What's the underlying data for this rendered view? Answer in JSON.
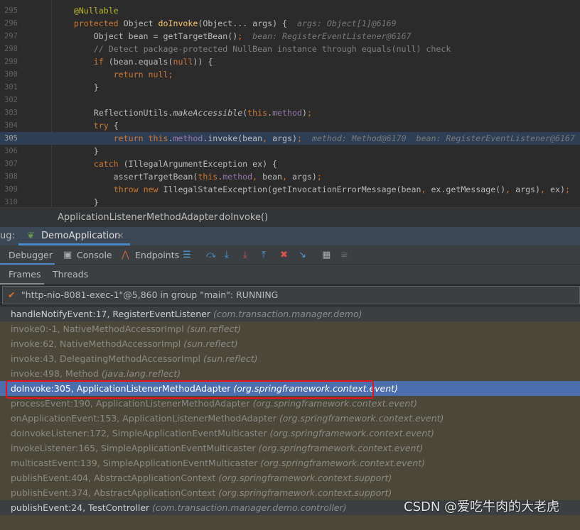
{
  "code": {
    "lines": [
      {
        "n": "295",
        "t": [
          [
            "        ",
            ""
          ],
          [
            "@Nullable",
            "an"
          ]
        ]
      },
      {
        "n": "296",
        "t": [
          [
            "        ",
            ""
          ],
          [
            "protected ",
            "kw"
          ],
          [
            "Object ",
            ""
          ],
          [
            "doInvoke",
            "fn"
          ],
          [
            "(Object... args) {  ",
            ""
          ],
          [
            "args: Object[1]@6169",
            "hint"
          ]
        ]
      },
      {
        "n": "297",
        "t": [
          [
            "            Object bean = getTargetBean()",
            ""
          ],
          [
            ";",
            "kw"
          ],
          [
            "  ",
            ""
          ],
          [
            "bean: RegisterEventListener@6167",
            "hint"
          ]
        ]
      },
      {
        "n": "298",
        "t": [
          [
            "            ",
            ""
          ],
          [
            "// Detect package-protected NullBean instance through equals(null) check",
            "cm"
          ]
        ]
      },
      {
        "n": "299",
        "t": [
          [
            "            ",
            ""
          ],
          [
            "if ",
            "kw"
          ],
          [
            "(bean.equals(",
            ""
          ],
          [
            "null",
            "kw"
          ],
          [
            ")) {",
            ""
          ]
        ]
      },
      {
        "n": "300",
        "t": [
          [
            "                ",
            ""
          ],
          [
            "return null;",
            "kw"
          ]
        ]
      },
      {
        "n": "301",
        "t": [
          [
            "            }",
            ""
          ]
        ]
      },
      {
        "n": "302",
        "t": []
      },
      {
        "n": "303",
        "t": [
          [
            "            ReflectionUtils.",
            ""
          ],
          [
            "makeAccessible",
            "it"
          ],
          [
            "(",
            ""
          ],
          [
            "this",
            "kw"
          ],
          [
            ".",
            ""
          ],
          [
            "method",
            "fd"
          ],
          [
            ")",
            ""
          ],
          [
            ";",
            "kw"
          ]
        ]
      },
      {
        "n": "304",
        "t": [
          [
            "            ",
            ""
          ],
          [
            "try ",
            "kw"
          ],
          [
            "{",
            ""
          ]
        ]
      },
      {
        "n": "305",
        "t": [
          [
            "                ",
            ""
          ],
          [
            "return this",
            "kw"
          ],
          [
            ".",
            ""
          ],
          [
            "method",
            "fd"
          ],
          [
            ".invoke(bean",
            ""
          ],
          [
            ", ",
            "kw"
          ],
          [
            "args)",
            ""
          ],
          [
            ";",
            "kw"
          ],
          [
            "  ",
            ""
          ],
          [
            "method: Method@6170  bean: RegisterEventListener@6167",
            "hint"
          ]
        ],
        "current": true
      },
      {
        "n": "306",
        "t": [
          [
            "            }",
            ""
          ]
        ]
      },
      {
        "n": "307",
        "t": [
          [
            "            ",
            ""
          ],
          [
            "catch ",
            "kw"
          ],
          [
            "(IllegalArgumentException ex) {",
            ""
          ]
        ]
      },
      {
        "n": "308",
        "t": [
          [
            "                assertTargetBean(",
            ""
          ],
          [
            "this",
            "kw"
          ],
          [
            ".",
            ""
          ],
          [
            "method",
            "fd"
          ],
          [
            ", ",
            "kw"
          ],
          [
            "bean",
            ""
          ],
          [
            ", ",
            "kw"
          ],
          [
            "args)",
            ""
          ],
          [
            ";",
            "kw"
          ]
        ]
      },
      {
        "n": "309",
        "t": [
          [
            "                ",
            ""
          ],
          [
            "throw new ",
            "kw"
          ],
          [
            "IllegalStateException(getInvocationErrorMessage(bean",
            ""
          ],
          [
            ", ",
            "kw"
          ],
          [
            "ex.getMessage()",
            ""
          ],
          [
            ", ",
            "kw"
          ],
          [
            "args)",
            ""
          ],
          [
            ", ",
            "kw"
          ],
          [
            "ex)",
            ""
          ],
          [
            ";",
            "kw"
          ]
        ]
      },
      {
        "n": "310",
        "t": [
          [
            "            }",
            ""
          ]
        ]
      }
    ]
  },
  "breadcrumb": {
    "class": "ApplicationListenerMethodAdapter",
    "method": "doInvoke()"
  },
  "debug": {
    "label": "ug:",
    "session": "DemoApplication",
    "close": "×"
  },
  "toolbar": {
    "debugger": "Debugger",
    "console": "Console",
    "endpoints": "Endpoints"
  },
  "subtabs": {
    "frames": "Frames",
    "threads": "Threads"
  },
  "thread": {
    "text": "\"http-nio-8081-exec-1\"@5,860 in group \"main\": RUNNING"
  },
  "frames": [
    {
      "m": "handleNotifyEvent:17, RegisterEventListener",
      "p": "(com.transaction.manager.demo)",
      "k": "app"
    },
    {
      "m": "invoke0:-1, NativeMethodAccessorImpl",
      "p": "(sun.reflect)",
      "k": "lib"
    },
    {
      "m": "invoke:62, NativeMethodAccessorImpl",
      "p": "(sun.reflect)",
      "k": "lib"
    },
    {
      "m": "invoke:43, DelegatingMethodAccessorImpl",
      "p": "(sun.reflect)",
      "k": "lib"
    },
    {
      "m": "invoke:498, Method",
      "p": "(java.lang.reflect)",
      "k": "lib"
    },
    {
      "m": "doInvoke:305, ApplicationListenerMethodAdapter",
      "p": "(org.springframework.context.event)",
      "k": "sel"
    },
    {
      "m": "processEvent:190, ApplicationListenerMethodAdapter",
      "p": "(org.springframework.context.event)",
      "k": "lib"
    },
    {
      "m": "onApplicationEvent:153, ApplicationListenerMethodAdapter",
      "p": "(org.springframework.context.event)",
      "k": "lib"
    },
    {
      "m": "doInvokeListener:172, SimpleApplicationEventMulticaster",
      "p": "(org.springframework.context.event)",
      "k": "lib"
    },
    {
      "m": "invokeListener:165, SimpleApplicationEventMulticaster",
      "p": "(org.springframework.context.event)",
      "k": "lib"
    },
    {
      "m": "multicastEvent:139, SimpleApplicationEventMulticaster",
      "p": "(org.springframework.context.event)",
      "k": "lib"
    },
    {
      "m": "publishEvent:404, AbstractApplicationContext",
      "p": "(org.springframework.context.support)",
      "k": "lib"
    },
    {
      "m": "publishEvent:374, AbstractApplicationContext",
      "p": "(org.springframework.context.support)",
      "k": "lib"
    },
    {
      "m": "publishEvent:24, TestController",
      "p": "(com.transaction.manager.demo.controller)",
      "k": "app"
    }
  ],
  "watermark": "CSDN @爱吃牛肉的大老虎",
  "colors": {
    "selection": "#4b6eaf",
    "highlight_box": "#e8141b",
    "library_frame": "#4c4839"
  }
}
